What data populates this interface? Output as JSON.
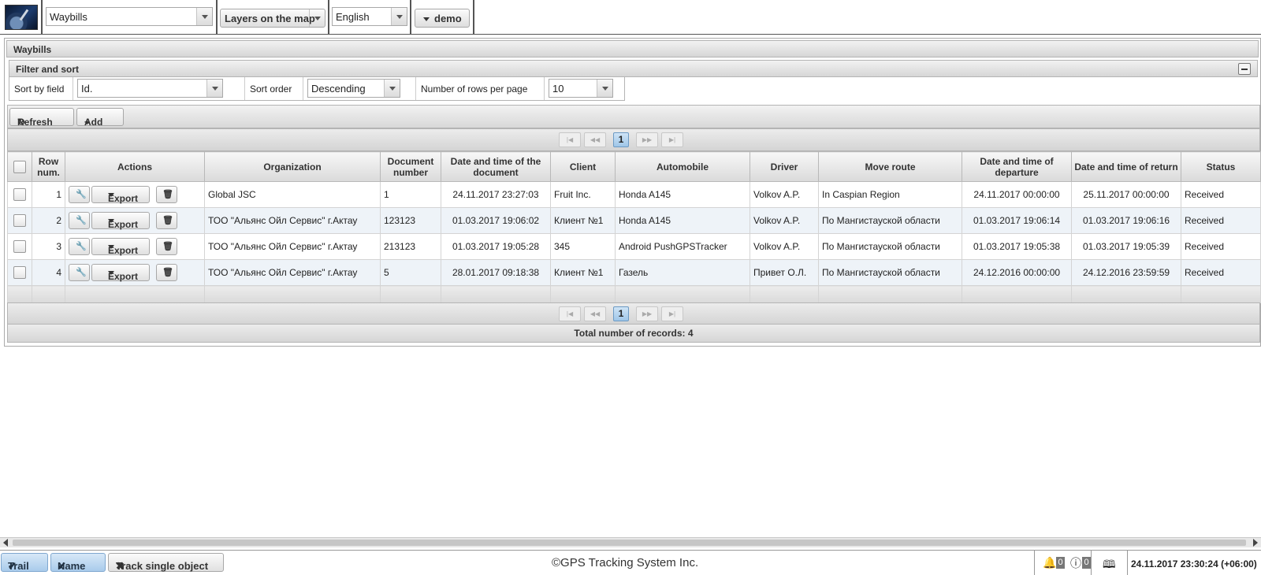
{
  "topbar": {
    "module_select": "Waybills",
    "layers_label": "Layers on the map",
    "language_select": "English",
    "user_label": "demo"
  },
  "panel": {
    "title": "Waybills",
    "filter": {
      "title": "Filter and sort",
      "sort_by_label": "Sort by field",
      "sort_by_value": "Id.",
      "sort_order_label": "Sort order",
      "sort_order_value": "Descending",
      "rows_label": "Number of rows per page",
      "rows_value": "10"
    },
    "toolbar": {
      "refresh_label": "Refresh",
      "add_label": "Add"
    },
    "pager": {
      "current_page": "1"
    },
    "columns": {
      "row_num": "Row num.",
      "actions": "Actions",
      "organization": "Organization",
      "document_number": "Document number",
      "document_date": "Date and time of the document",
      "client": "Client",
      "automobile": "Automobile",
      "driver": "Driver",
      "route": "Move route",
      "departure": "Date and time of departure",
      "return": "Date and time of return",
      "status": "Status"
    },
    "export_label": "Export",
    "rows": [
      {
        "num": "1",
        "organization": "Global JSC",
        "doc_num": "1",
        "doc_date": "24.11.2017 23:27:03",
        "client": "Fruit Inc.",
        "automobile": "Honda A145",
        "driver": "Volkov A.P.",
        "route": "In Caspian Region",
        "departure": "24.11.2017 00:00:00",
        "return": "25.11.2017 00:00:00",
        "status": "Received"
      },
      {
        "num": "2",
        "organization": "ТОО \"Альянс Ойл Сервис\" г.Актау",
        "doc_num": "123123",
        "doc_date": "01.03.2017 19:06:02",
        "client": "Клиент №1",
        "automobile": "Honda A145",
        "driver": "Volkov A.P.",
        "route": "По Мангистауской области",
        "departure": "01.03.2017 19:06:14",
        "return": "01.03.2017 19:06:16",
        "status": "Received"
      },
      {
        "num": "3",
        "organization": "ТОО \"Альянс Ойл Сервис\" г.Актау",
        "doc_num": "213123",
        "doc_date": "01.03.2017 19:05:28",
        "client": "345",
        "automobile": "Android PushGPSTracker",
        "driver": "Volkov A.P.",
        "route": "По Мангистауской области",
        "departure": "01.03.2017 19:05:38",
        "return": "01.03.2017 19:05:39",
        "status": "Received"
      },
      {
        "num": "4",
        "organization": "ТОО \"Альянс Ойл Сервис\" г.Актау",
        "doc_num": "5",
        "doc_date": "28.01.2017 09:18:38",
        "client": "Клиент №1",
        "automobile": "Газель",
        "driver": "Привет О.Л.",
        "route": "По Мангистауской области",
        "departure": "24.12.2016 00:00:00",
        "return": "24.12.2016 23:59:59",
        "status": "Received"
      }
    ],
    "total_records": "Total number of records: 4"
  },
  "statusbar": {
    "trail_label": "Trail",
    "name_label": "Name",
    "track_label": "Track single object",
    "copyright": "©GPS Tracking System Inc.",
    "notifications_count": "0",
    "info_count": "0",
    "datetime": "24.11.2017 23:30:24 (+06:00)"
  },
  "colors": {
    "accent_active": "#a9cbeb",
    "pager_current": "#9fc6e8",
    "header_gradient_end": "#dadada"
  }
}
